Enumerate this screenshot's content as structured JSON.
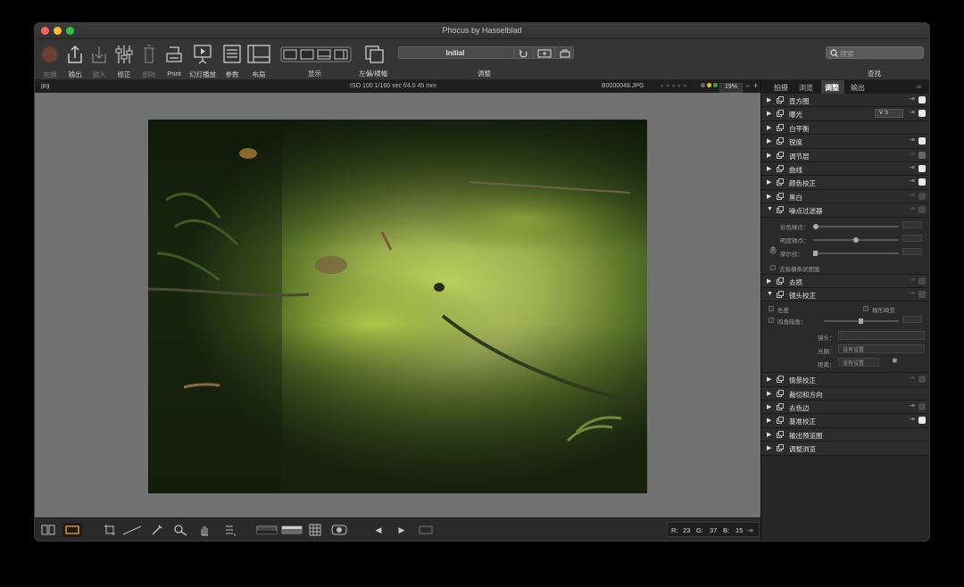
{
  "window": {
    "title": "Phocus by Hasselblad"
  },
  "toolbar": {
    "items": [
      {
        "label": "拍摄",
        "icon": "capture-icon",
        "enabled": false
      },
      {
        "label": "输出",
        "icon": "export-icon",
        "enabled": true
      },
      {
        "label": "输入",
        "icon": "import-icon",
        "enabled": false
      },
      {
        "label": "修正",
        "icon": "adjust-icon",
        "enabled": true
      },
      {
        "label": "删除",
        "icon": "trash-icon",
        "enabled": false
      },
      {
        "label": "Print",
        "icon": "print-icon",
        "enabled": true
      },
      {
        "label": "幻灯播放",
        "icon": "slideshow-icon",
        "enabled": true
      },
      {
        "label": "参数",
        "icon": "parameters-icon",
        "enabled": true
      },
      {
        "label": "布局",
        "icon": "layout-icon",
        "enabled": true
      }
    ],
    "display_label": "显示",
    "compare_label": "左偏/横幅",
    "adjust_label": "调整",
    "find_label": "查找",
    "preset_value": "Initial",
    "search_placeholder": "搜索"
  },
  "info": {
    "format": "jpg",
    "exif": "ISO 100  1/160 sec  f/4.0  45 mm",
    "filename": "B0000048.JPG",
    "zoom": "19%",
    "colors": {
      "yellow": "#e6c200",
      "green": "#3aaa3a"
    }
  },
  "tabs": [
    "拍摄",
    "浏览",
    "调整",
    "输出"
  ],
  "active_tab": "调整",
  "panel": {
    "rows": [
      {
        "name": "直方图",
        "checked": true
      },
      {
        "name": "曝光",
        "checked": true,
        "select": "V 3"
      },
      {
        "name": "白平衡",
        "checked": null
      },
      {
        "name": "锐度",
        "checked": true
      },
      {
        "name": "调节层",
        "checked": true
      },
      {
        "name": "曲线",
        "checked": true
      },
      {
        "name": "颜色校正",
        "checked": true
      },
      {
        "name": "黑白",
        "checked": false
      }
    ],
    "noise": {
      "name": "噪点过滤器",
      "color_label": "彩色噪点：",
      "luma_label": "明度噪点：",
      "moire_label": "摩尔纹：",
      "remove_pattern_label": "去除横条状图案"
    },
    "rows2": [
      {
        "name": "去损",
        "checked": false
      }
    ],
    "lens": {
      "name": "镜头校正",
      "color_label": "色差",
      "distortion_label": "桶形畸变",
      "vignette_label": "四角暗角：",
      "lens_label": "镜头：",
      "aperture_label": "光圈：",
      "aperture_value": "没有设置",
      "focus_label": "距离：",
      "focus_value": "没有设置"
    },
    "rows3": [
      {
        "name": "情景校正",
        "checked": false
      },
      {
        "name": "裁切和方向",
        "checked": null
      },
      {
        "name": "去色边",
        "checked": false
      },
      {
        "name": "基准校正",
        "checked": true
      },
      {
        "name": "输出预览图",
        "checked": null
      },
      {
        "name": "调整浏览",
        "checked": null
      }
    ]
  },
  "status": {
    "r_label": "R:",
    "r": "23",
    "g_label": "G:",
    "g": "37",
    "b_label": "B:",
    "b": "15"
  }
}
